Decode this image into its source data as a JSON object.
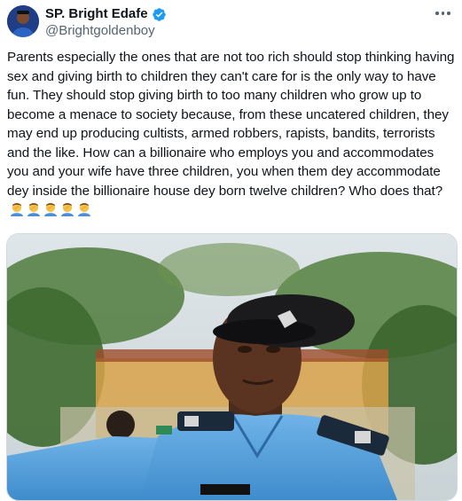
{
  "author": {
    "display_name": "SP. Bright Edafe",
    "handle": "@Brightgoldenboy",
    "verified": true,
    "avatar_icon": "profile-avatar"
  },
  "tweet": {
    "text": "Parents especially the ones that are not too rich should stop thinking having sex and giving birth to children they can't care for is the only way to have fun. They should stop giving birth to too many children who grow up to become a menace to society because, from these uncatered children, they may end up producing cultists, armed robbers, rapists, bandits, terrorists and the like. How can a billionaire who employs you and accommodates you and your wife have three children, you when them dey accommodate dey inside the billionaire house dey born twelve children? Who does that?",
    "emoji": [
      "man-facepalming",
      "man-facepalming",
      "man-facepalming",
      "man-facepalming",
      "man-facepalming"
    ]
  },
  "media": {
    "description_icon": "photo-police-officer"
  },
  "colors": {
    "verified": "#1d9bf0",
    "secondary_text": "#536471",
    "uniform_blue": "#5aa6e0"
  }
}
